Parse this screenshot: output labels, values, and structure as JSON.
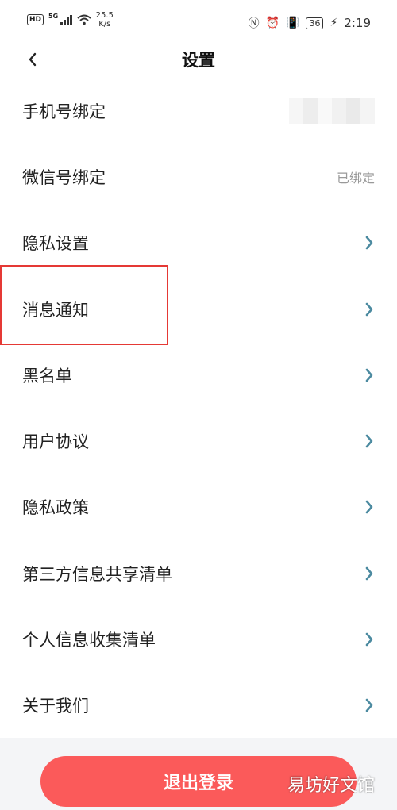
{
  "status_bar": {
    "hd": "HD",
    "network": "5G",
    "speed_value": "25.5",
    "speed_unit": "K/s",
    "battery": "36",
    "time": "2:19"
  },
  "header": {
    "title": "设置",
    "back_icon": "chevron-left-icon"
  },
  "settings": {
    "items": [
      {
        "label": "手机号绑定",
        "value": "",
        "masked": true
      },
      {
        "label": "微信号绑定",
        "value": "已绑定"
      },
      {
        "label": "隐私设置"
      },
      {
        "label": "消息通知",
        "highlighted": true
      },
      {
        "label": "黑名单"
      },
      {
        "label": "用户协议"
      },
      {
        "label": "隐私政策"
      },
      {
        "label": "第三方信息共享清单"
      },
      {
        "label": "个人信息收集清单"
      },
      {
        "label": "关于我们"
      }
    ]
  },
  "logout": {
    "label": "退出登录"
  },
  "watermark": {
    "text": "易坊好文馆"
  },
  "colors": {
    "accent_chevron": "#4b8aa0",
    "logout_button": "#fb5a5a",
    "highlight_border": "#e53935",
    "value_text": "#999999"
  }
}
